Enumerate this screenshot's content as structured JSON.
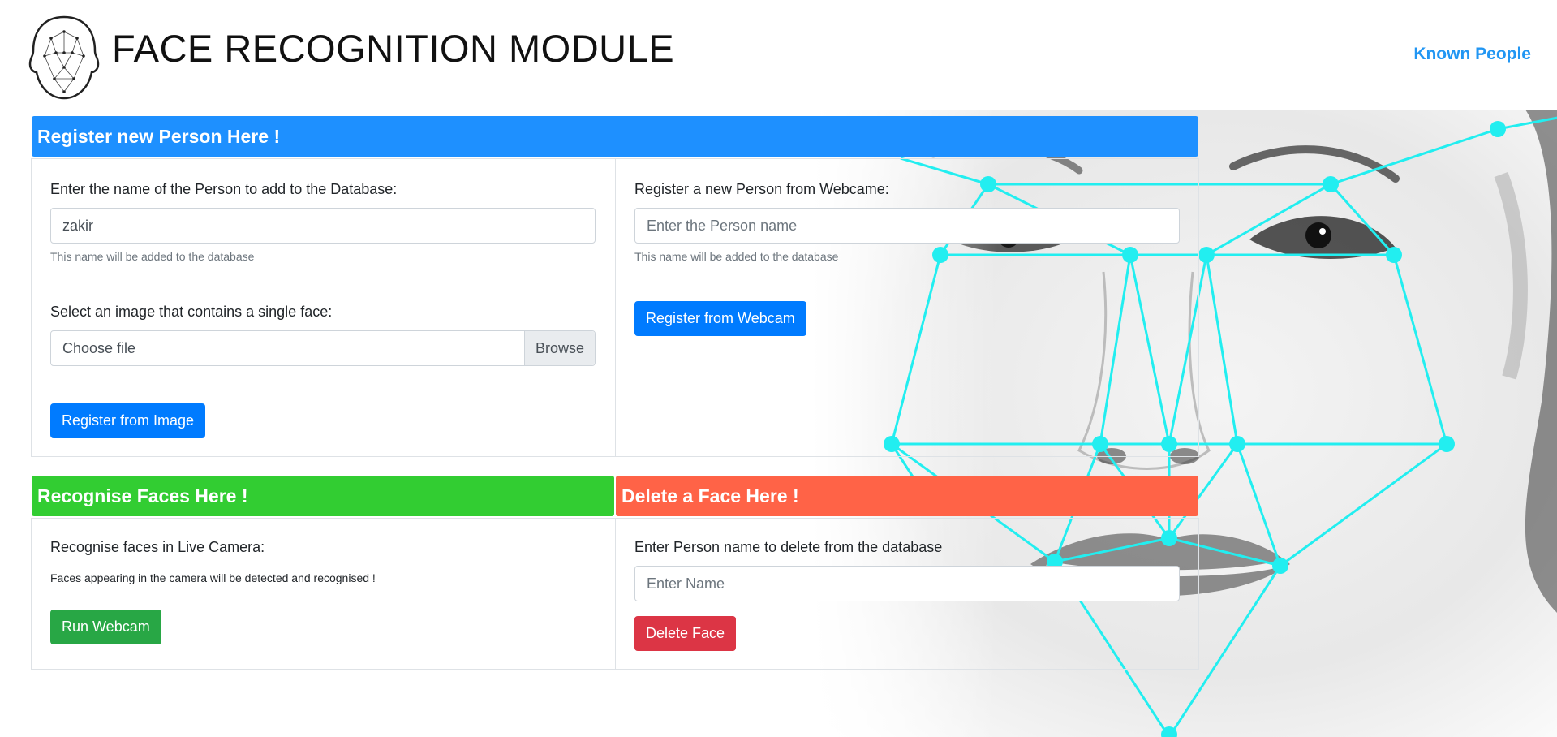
{
  "header": {
    "title": "FACE RECOGNITION MODULE",
    "nav_link": "Known People"
  },
  "register": {
    "heading": "Register new Person Here !",
    "image_section": {
      "name_label": "Enter the name of the Person to add to the Database:",
      "name_value": "zakir",
      "name_hint": "This name will be added to the database",
      "file_label": "Select an image that contains a single face:",
      "file_placeholder": "Choose file",
      "browse_label": "Browse",
      "submit_label": "Register from Image"
    },
    "webcam_section": {
      "name_label": "Register a new Person from Webcame:",
      "name_placeholder": "Enter the Person name",
      "name_hint": "This name will be added to the database",
      "submit_label": "Register from Webcam"
    }
  },
  "recognise": {
    "heading": "Recognise Faces Here !",
    "label": "Recognise faces in Live Camera:",
    "description": "Faces appearing in the camera will be detected and recognised !",
    "button_label": "Run Webcam"
  },
  "delete": {
    "heading": "Delete a Face Here !",
    "label": "Enter Person name to delete from the database",
    "placeholder": "Enter Name",
    "button_label": "Delete Face"
  },
  "colors": {
    "register_header": "#1e90ff",
    "recognise_header": "#32cd32",
    "delete_header": "#ff6347",
    "primary_button": "#007bff",
    "success_button": "#28a745",
    "danger_button": "#dc3545",
    "nav_link": "#2196f3",
    "mesh_accent": "#22eef0"
  }
}
